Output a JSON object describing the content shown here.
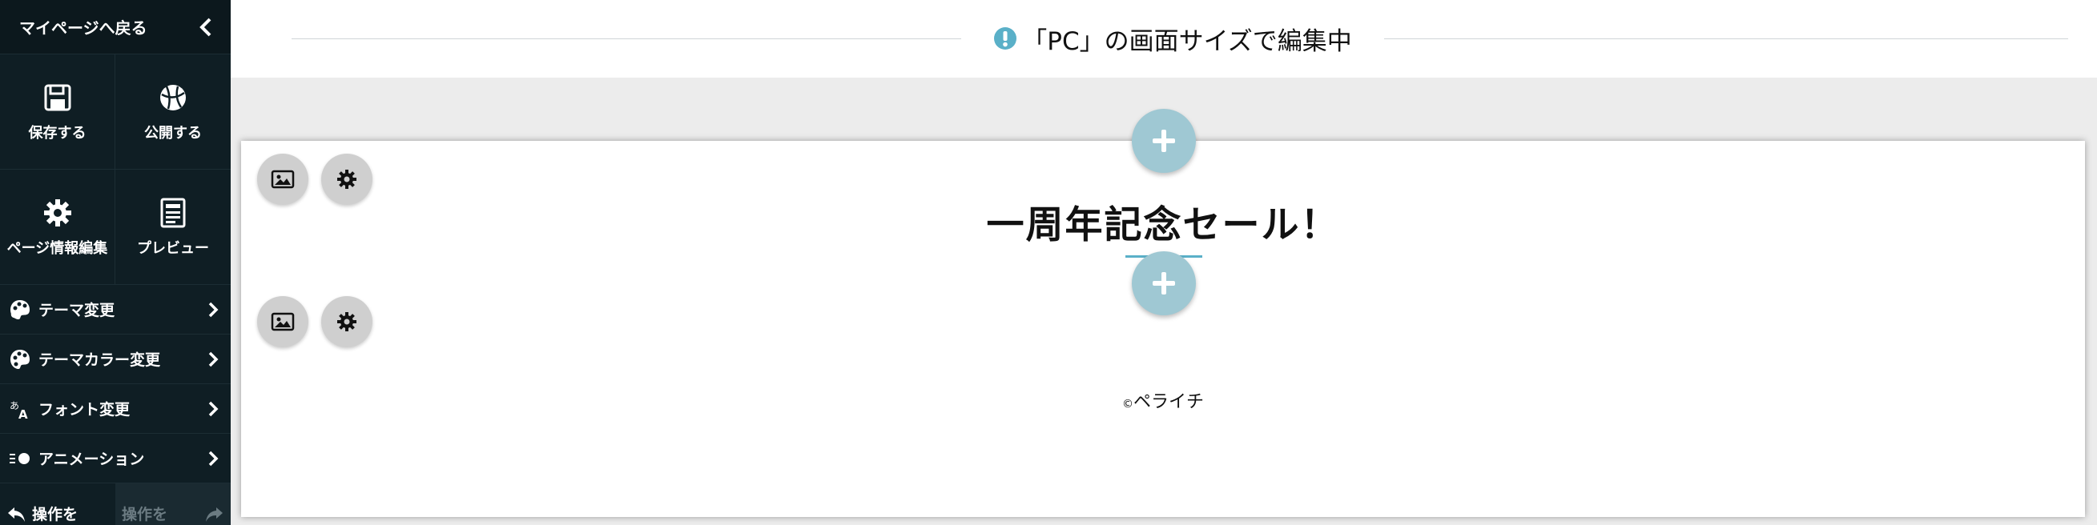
{
  "sidebar": {
    "back_label": "マイページへ戻る",
    "tiles": [
      {
        "label": "保存する",
        "icon": "save-icon"
      },
      {
        "label": "公開する",
        "icon": "publish-icon"
      },
      {
        "label": "ページ情報編集",
        "icon": "gear-icon"
      },
      {
        "label": "プレビュー",
        "icon": "preview-icon"
      }
    ],
    "menu": [
      {
        "label": "テーマ変更",
        "icon": "palette-icon"
      },
      {
        "label": "テーマカラー変更",
        "icon": "palette-icon"
      },
      {
        "label": "フォント変更",
        "icon": "font-icon"
      },
      {
        "label": "アニメーション",
        "icon": "animation-icon"
      }
    ],
    "undo_label": "操作を",
    "redo_label": "操作を"
  },
  "header": {
    "message": "「PC」の画面サイズで編集中",
    "accent": "#5ab0c8"
  },
  "page": {
    "heading": "一周年記念セール！",
    "copyright_symbol": "©",
    "footer": "ペライチ"
  },
  "colors": {
    "sidebar_bg": "#0f1e24",
    "add_button": "#9fc8d3",
    "tool_button": "#cfcfcf"
  }
}
